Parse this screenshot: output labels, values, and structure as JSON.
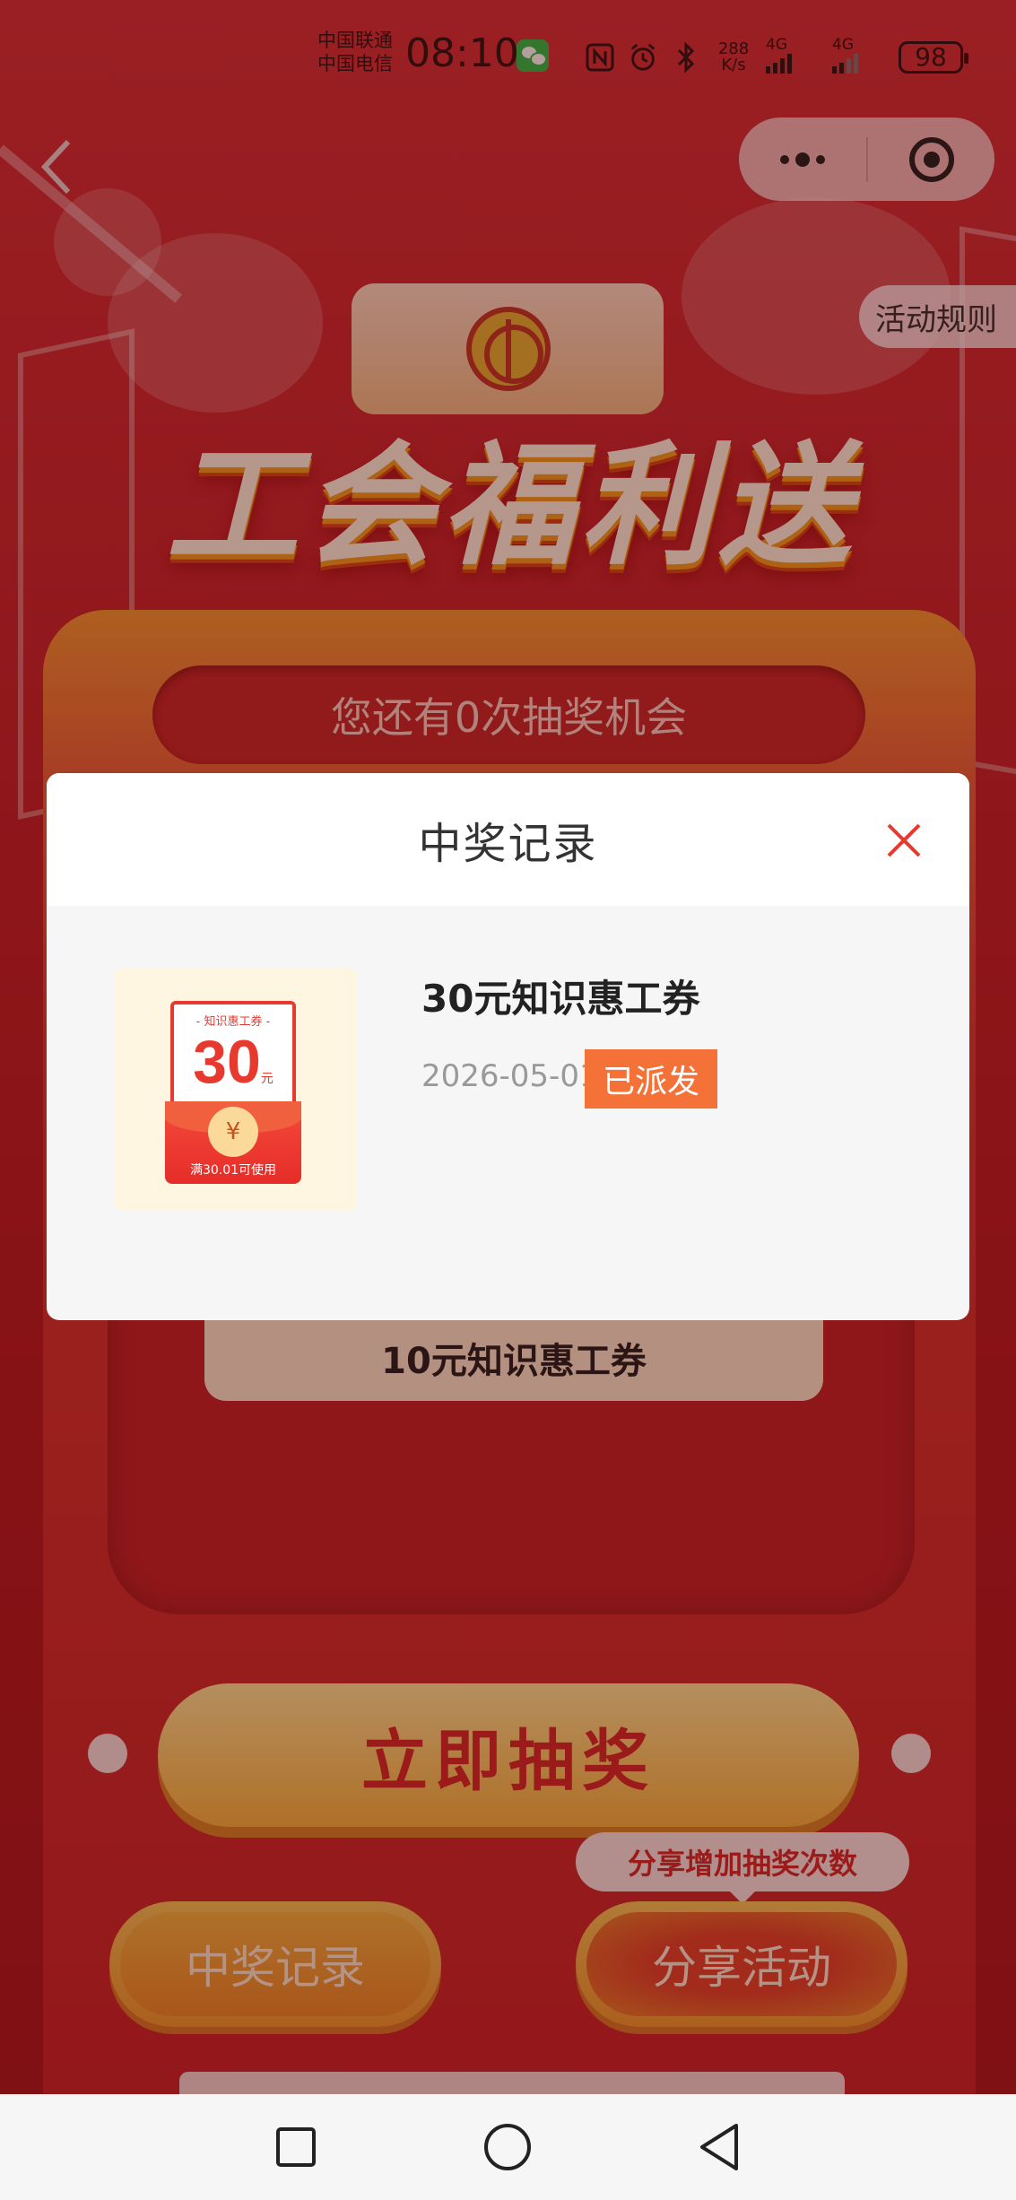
{
  "status_bar": {
    "carrier_1": "中国联通",
    "carrier_2": "中国电信",
    "time": "08:10",
    "net_speed": "288\nK/s",
    "net_1": "4G",
    "net_2": "4G",
    "battery": "98"
  },
  "header": {
    "rules_label": "活动规则"
  },
  "banner": {
    "title": "工会福利送"
  },
  "lottery": {
    "chances_text": "您还有0次抽奖机会",
    "prize_label": "10元知识惠工券",
    "draw_button": "立即抽奖",
    "share_tip": "分享增加抽奖次数",
    "records_button": "中奖记录",
    "share_button": "分享活动"
  },
  "modal": {
    "title": "中奖记录",
    "records": [
      {
        "name": "30元知识惠工券",
        "date": "2026-05-01",
        "status": "已派发",
        "coupon": {
          "header": "- 知识惠工券 -",
          "amount": "30",
          "unit": "元",
          "currency": "¥",
          "condition": "满30.01可使用"
        }
      }
    ]
  },
  "colors": {
    "accent_red": "#e8392f",
    "status_orange": "#f47238",
    "modal_bg": "#f6f6f6"
  },
  "icons": [
    "back-icon",
    "more-icon",
    "mini-close-icon",
    "close-icon",
    "wechat-icon",
    "nfc-icon",
    "alarm-icon",
    "bluetooth-icon",
    "recent-apps-icon",
    "home-icon",
    "back-nav-icon"
  ]
}
